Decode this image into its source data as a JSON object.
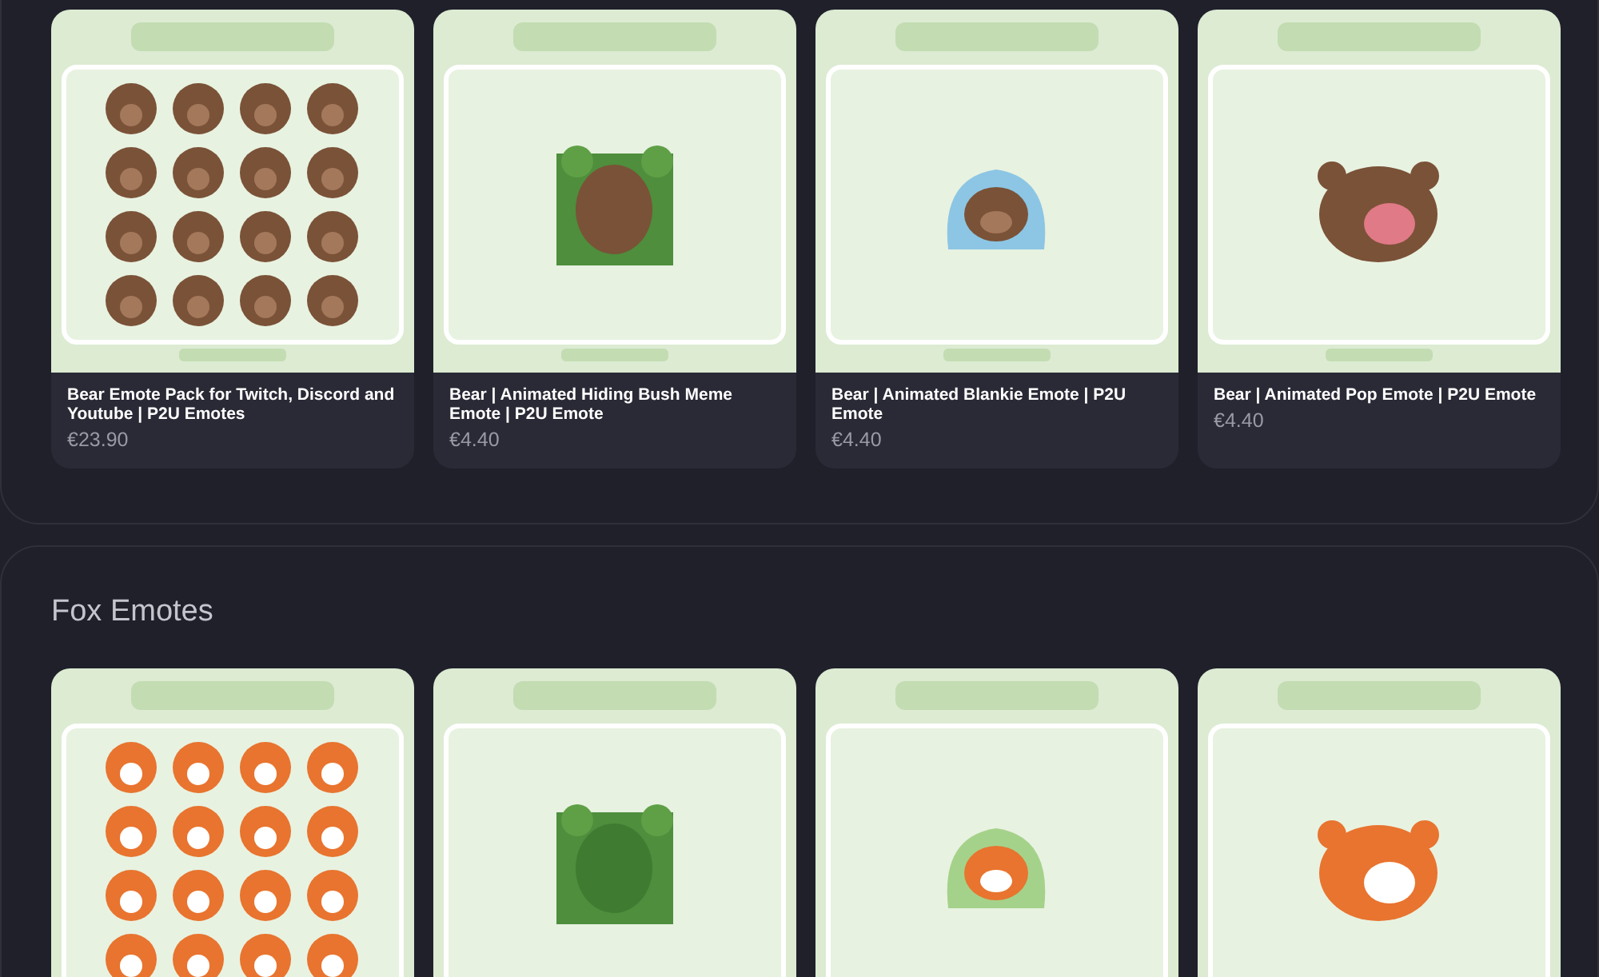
{
  "sections": [
    {
      "products": [
        {
          "kind": "picture",
          "title": "Bear Emote Pack for Twitch, Discord and Youtube | P2U Emotes",
          "price": "€23.90"
        },
        {
          "kind": "picture",
          "title": "Bear | Animated Hiding Bush Meme Emote | P2U Emote",
          "price": "€4.40"
        },
        {
          "kind": "picture",
          "title": "Bear | Animated Blankie Emote | P2U Emote",
          "price": "€4.40"
        },
        {
          "kind": "picture",
          "title": "Bear | Animated Pop Emote | P2U Emote",
          "price": "€4.40"
        }
      ]
    },
    {
      "title": "Fox Emotes"
    }
  ]
}
